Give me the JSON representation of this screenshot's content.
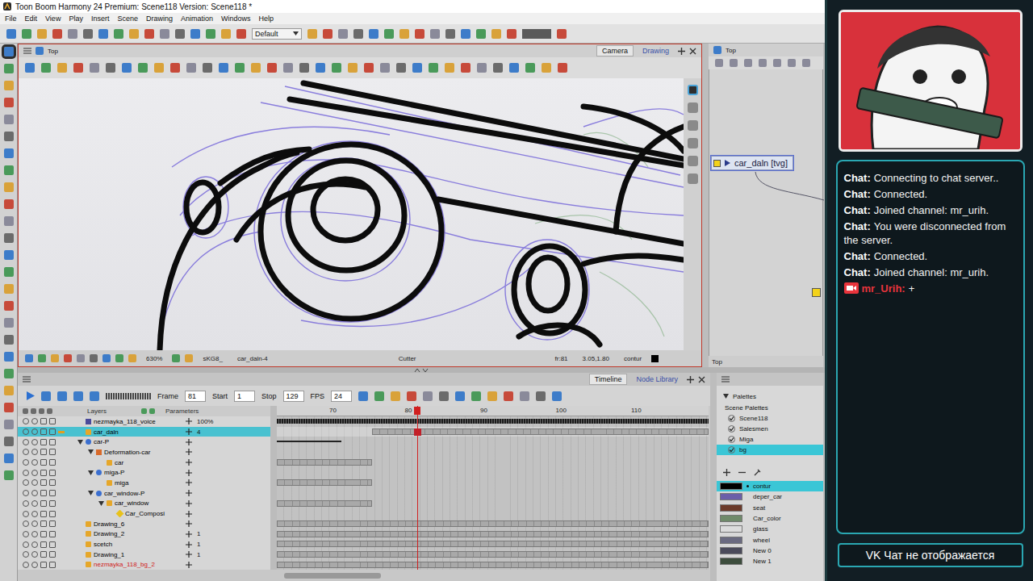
{
  "window": {
    "title": "Toon Boom Harmony 24 Premium: Scene118 Version: Scene118 *"
  },
  "menu": [
    "File",
    "Edit",
    "View",
    "Play",
    "Insert",
    "Scene",
    "Drawing",
    "Animation",
    "Windows",
    "Help"
  ],
  "toolbar": {
    "workspace": "Default"
  },
  "camera_view": {
    "title": "Top",
    "tabs": [
      {
        "label": "Camera",
        "selected": true
      },
      {
        "label": "Drawing",
        "selected": false
      }
    ],
    "status": {
      "zoom": "630%",
      "code": "sKG8_",
      "drawing": "car_daln-4",
      "tool": "Cutter",
      "frame": "fr:81",
      "coords": "3.05,1.80",
      "color": "contur"
    }
  },
  "node_view": {
    "title": "Top",
    "footer": "Top",
    "nodes": [
      {
        "label": "car_daln [tvg]",
        "selected": true
      }
    ]
  },
  "timeline": {
    "tabs": [
      {
        "label": "Timeline",
        "selected": true
      },
      {
        "label": "Node Library",
        "selected": false
      }
    ],
    "frame_label": "Frame",
    "frame": "81",
    "start_label": "Start",
    "start": "1",
    "stop_label": "Stop",
    "stop": "129",
    "fps_label": "FPS",
    "fps": "24",
    "columns": [
      "Layers",
      "Parameters"
    ],
    "ruler": [
      "70",
      "80",
      "90",
      "100",
      "110"
    ],
    "layers": [
      {
        "name": "nezmayka_118_voice",
        "kind": "sound",
        "depth": 0,
        "selected": false,
        "param": "100%",
        "color": "#000000",
        "exposure": [
          62,
          120
        ]
      },
      {
        "name": "car_daln",
        "kind": "drawing",
        "depth": 0,
        "selected": true,
        "param": "4",
        "color": "#000000",
        "exposure": [
          75,
          120
        ]
      },
      {
        "name": "car-P",
        "kind": "peg",
        "depth": 0,
        "selected": false,
        "param": "",
        "color": "#000000",
        "expanded": true,
        "exposure": [
          62,
          71
        ]
      },
      {
        "name": "Deformation-car",
        "kind": "deformation",
        "depth": 1,
        "selected": false,
        "param": "",
        "color": "#000000",
        "expanded": true,
        "exposure": null
      },
      {
        "name": "car",
        "kind": "drawing",
        "depth": 2,
        "selected": false,
        "param": "",
        "color": "#000000",
        "exposure": [
          62,
          75
        ]
      },
      {
        "name": "miga-P",
        "kind": "peg",
        "depth": 1,
        "selected": false,
        "param": "",
        "color": "#000000",
        "expanded": true,
        "exposure": null
      },
      {
        "name": "miga",
        "kind": "drawing",
        "depth": 2,
        "selected": false,
        "param": "",
        "color": "#000000",
        "exposure": [
          62,
          75
        ]
      },
      {
        "name": "car_window-P",
        "kind": "peg",
        "depth": 1,
        "selected": false,
        "param": "",
        "color": "#000000",
        "expanded": true,
        "exposure": null
      },
      {
        "name": "car_window",
        "kind": "drawing",
        "depth": 2,
        "selected": false,
        "param": "",
        "color": "#000000",
        "expanded": true,
        "exposure": [
          62,
          75
        ]
      },
      {
        "name": "Car_Composi",
        "kind": "composite",
        "depth": 3,
        "selected": false,
        "param": "",
        "color": "#000000",
        "exposure": null
      },
      {
        "name": "Drawing_6",
        "kind": "drawing",
        "depth": 0,
        "selected": false,
        "param": "",
        "color": "#000000",
        "exposure": [
          62,
          120
        ]
      },
      {
        "name": "Drawing_2",
        "kind": "drawing",
        "depth": 0,
        "selected": false,
        "param": "1",
        "color": "#000000",
        "exposure": [
          62,
          120
        ]
      },
      {
        "name": "scetch",
        "kind": "drawing",
        "depth": 0,
        "selected": false,
        "param": "1",
        "color": "#000000",
        "exposure": [
          62,
          120
        ]
      },
      {
        "name": "Drawing_1",
        "kind": "drawing",
        "depth": 0,
        "selected": false,
        "param": "1",
        "color": "#000000",
        "exposure": [
          62,
          120
        ]
      },
      {
        "name": "nezmayka_118_bg_2",
        "kind": "drawing",
        "depth": 0,
        "selected": false,
        "param": "",
        "color": "#d01818",
        "exposure": [
          62,
          120
        ]
      }
    ]
  },
  "palettes": {
    "title": "Palettes",
    "group": "Scene Palettes",
    "lists": [
      {
        "name": "Scene118",
        "checked": true,
        "selected": false
      },
      {
        "name": "Salesmen",
        "checked": true,
        "selected": false
      },
      {
        "name": "Miga",
        "checked": true,
        "selected": false
      },
      {
        "name": "bg",
        "checked": true,
        "selected": true
      }
    ],
    "colors": [
      {
        "name": "contur",
        "color": "#000000",
        "selected": true
      },
      {
        "name": "deper_car",
        "color": "#6b5fa8",
        "selected": false
      },
      {
        "name": "seat",
        "color": "#6b3a2a",
        "selected": false
      },
      {
        "name": "Car_color",
        "color": "#6f8a6a",
        "selected": false
      },
      {
        "name": "glass",
        "color": "#dcdcdc",
        "selected": false
      },
      {
        "name": "wheel",
        "color": "#6a6a80",
        "selected": false
      },
      {
        "name": "New 0",
        "color": "#4a4a5a",
        "selected": false
      },
      {
        "name": "New 1",
        "color": "#3c4c3c",
        "selected": false
      }
    ]
  },
  "stream": {
    "chat": [
      {
        "sender": "Chat:",
        "text": "Connecting to chat server..",
        "kind": "system",
        "color": "#ffffff"
      },
      {
        "sender": "Chat:",
        "text": "Connected.",
        "kind": "system",
        "color": "#ffffff"
      },
      {
        "sender": "Chat:",
        "text": "Joined channel: mr_urih.",
        "kind": "system",
        "color": "#ffffff"
      },
      {
        "sender": "Chat:",
        "text": "You were disconnected from the server.",
        "kind": "system",
        "color": "#ffffff"
      },
      {
        "sender": "Chat:",
        "text": "Connected.",
        "kind": "system",
        "color": "#ffffff"
      },
      {
        "sender": "Chat:",
        "text": "Joined channel: mr_urih.",
        "kind": "system",
        "color": "#ffffff"
      },
      {
        "sender": "mr_Urih:",
        "text": "+",
        "kind": "user",
        "color": "#e8343c"
      }
    ],
    "footer": "VK Чат не отображается"
  }
}
